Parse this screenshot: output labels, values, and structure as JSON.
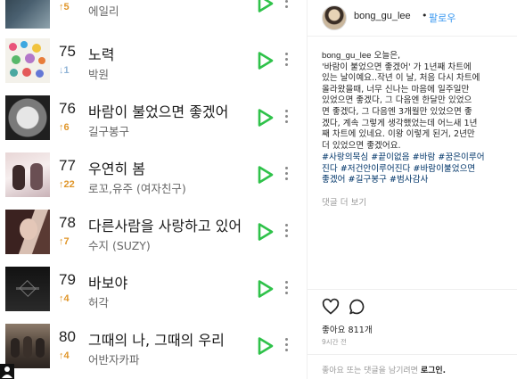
{
  "chart": {
    "rows": [
      {
        "rank": "",
        "change_dir": "up",
        "change": "5",
        "title": "",
        "artist": "에일리"
      },
      {
        "rank": "75",
        "change_dir": "down",
        "change": "1",
        "title": "노력",
        "artist": "박원"
      },
      {
        "rank": "76",
        "change_dir": "up",
        "change": "6",
        "title": "바람이 불었으면 좋겠어",
        "artist": "길구봉구"
      },
      {
        "rank": "77",
        "change_dir": "up",
        "change": "22",
        "title": "우연히 봄",
        "artist": "로꼬,유주 (여자친구)"
      },
      {
        "rank": "78",
        "change_dir": "up",
        "change": "7",
        "title": "다른사람을 사랑하고 있어",
        "artist": "수지 (SUZY)"
      },
      {
        "rank": "79",
        "change_dir": "up",
        "change": "4",
        "title": "바보야",
        "artist": "허각"
      },
      {
        "rank": "80",
        "change_dir": "up",
        "change": "4",
        "title": "그때의 나, 그때의 우리",
        "artist": "어반자카파"
      }
    ],
    "colors": {
      "play": "#2fc24a",
      "up": "#e0962a",
      "down": "#8fb3d6"
    }
  },
  "post": {
    "username": "bong_gu_lee",
    "separator": "•",
    "follow_label": "팔로우",
    "caption_user": "bong_gu_lee",
    "caption_lines": [
      " 오늘은,",
      "'바람이 불었으면 좋겠어' 가 1년째 차트에",
      "있는 날이예요..작년 이 날, 처음 다시 차트에",
      "올라왔을때, 너무 신나는 마음에 일주일만",
      "있었으면 좋겠다, 그 다음엔 한달만 있었으",
      "면 좋겠다, 그 다음엔 3개월만 있었으면 좋",
      "겠다, 계속 그렇게 생각했었는데 어느새 1년",
      "째 차트에 있네요. 이왕 이렇게 된거, 2년만",
      "더 있었으면 좋겠어요."
    ],
    "hashtag_lines": [
      "#사랑의묵심 #끝이없음 #바람 #꿈은이루어",
      "진다 #저건안이루어진다 #바람이불었으면",
      "좋겠어 #길구봉구 #범사감사"
    ],
    "more_comments": "댓글 더 보기",
    "likes": "좋아요 811개",
    "time_ago": "9시간 전",
    "comment_placeholder": "좋아요 또는 댓글을 남기려면",
    "login_label": "로그인."
  }
}
